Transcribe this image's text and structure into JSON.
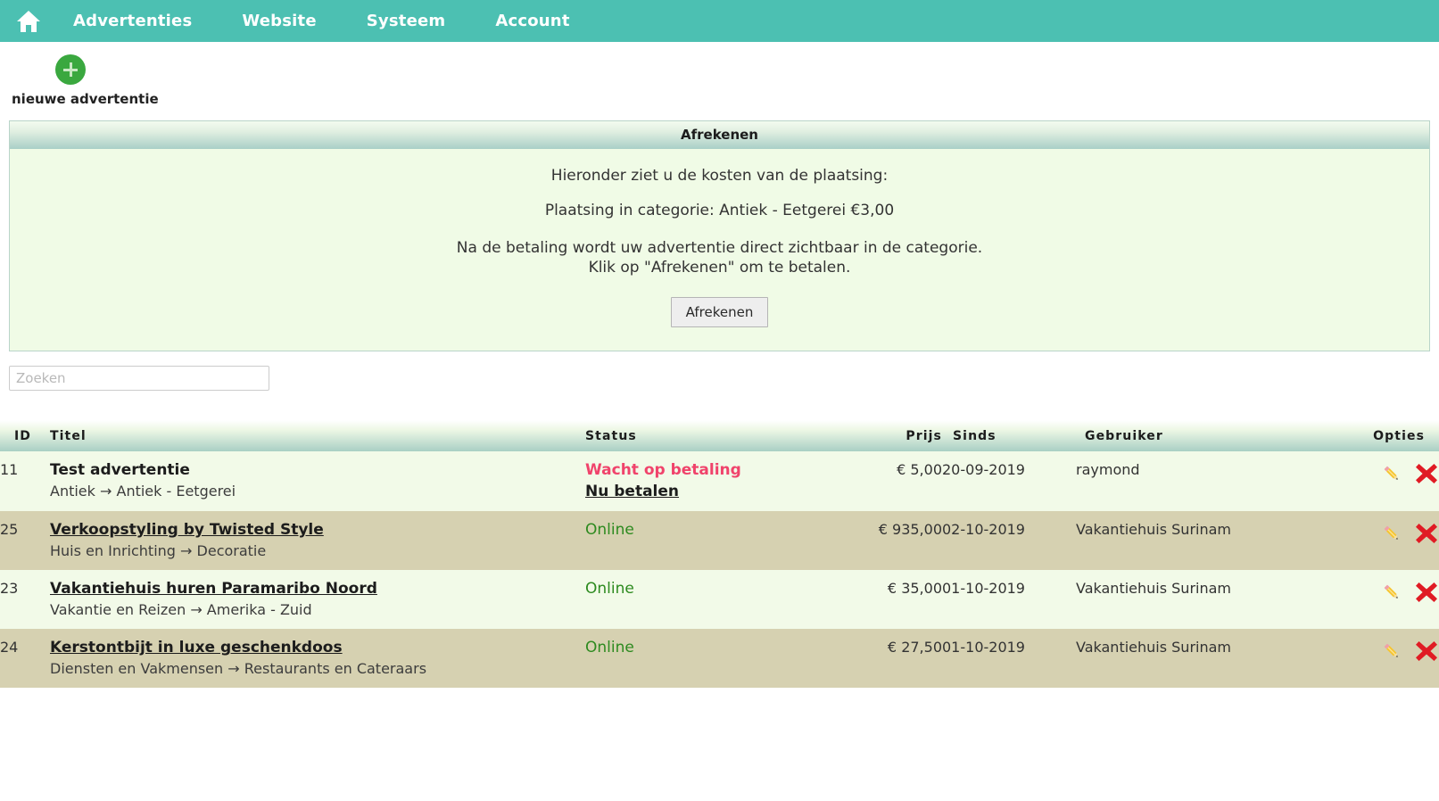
{
  "navbar": {
    "home_icon": "home-icon",
    "items": [
      {
        "label": "Advertenties"
      },
      {
        "label": "Website"
      },
      {
        "label": "Systeem"
      },
      {
        "label": "Account"
      }
    ],
    "background": "#4cc0b2"
  },
  "new_ad": {
    "icon": "plus-circle-icon",
    "label": "nieuwe advertentie",
    "circle_color": "#3aa83f"
  },
  "checkout_panel": {
    "title": "Afrekenen",
    "line1": "Hieronder ziet u de kosten van de plaatsing:",
    "line2": "Plaatsing in categorie: Antiek - Eetgerei €3,00",
    "line3a": "Na de betaling wordt uw advertentie direct zichtbaar in de categorie.",
    "line3b": "Klik op \"Afrekenen\" om te betalen.",
    "button_label": "Afrekenen"
  },
  "search": {
    "placeholder": "Zoeken",
    "value": ""
  },
  "table": {
    "headers": {
      "id": "ID",
      "title": "Titel",
      "status": "Status",
      "price": "Prijs",
      "since": "Sinds",
      "user": "Gebruiker",
      "options": "Opties"
    },
    "rows": [
      {
        "id": "11",
        "title": "Test advertentie",
        "title_is_link": false,
        "category": "Antiek → Antiek - Eetgerei",
        "status": "Wacht op betaling",
        "status_type": "wait",
        "status_color": "#f0436b",
        "pay_link": "Nu betalen",
        "price": "€ 5,00",
        "since": "20-09-2019",
        "user": "raymond",
        "edit_icon": "pencil-icon",
        "delete_icon": "red-cross-icon",
        "shade": "light"
      },
      {
        "id": "25",
        "title": "Verkoopstyling by Twisted Style",
        "title_is_link": true,
        "category": "Huis en Inrichting → Decoratie",
        "status": "Online",
        "status_type": "online",
        "status_color": "#2d8a1f",
        "pay_link": "",
        "price": "€ 935,00",
        "since": "02-10-2019",
        "user": "Vakantiehuis Surinam",
        "edit_icon": "pencil-icon",
        "delete_icon": "red-cross-icon",
        "shade": "dark"
      },
      {
        "id": "23",
        "title": "Vakantiehuis huren Paramaribo Noord",
        "title_is_link": true,
        "category": "Vakantie en Reizen → Amerika - Zuid",
        "status": "Online",
        "status_type": "online",
        "status_color": "#2d8a1f",
        "pay_link": "",
        "price": "€ 35,00",
        "since": "01-10-2019",
        "user": "Vakantiehuis Surinam",
        "edit_icon": "pencil-icon",
        "delete_icon": "red-cross-icon",
        "shade": "light"
      },
      {
        "id": "24",
        "title": "Kerstontbijt in luxe geschenkdoos",
        "title_is_link": true,
        "category": "Diensten en Vakmensen → Restaurants en Cateraars",
        "status": "Online",
        "status_type": "online",
        "status_color": "#2d8a1f",
        "pay_link": "",
        "price": "€ 27,50",
        "since": "01-10-2019",
        "user": "Vakantiehuis Surinam",
        "edit_icon": "pencil-icon",
        "delete_icon": "red-cross-icon",
        "shade": "dark"
      }
    ]
  }
}
